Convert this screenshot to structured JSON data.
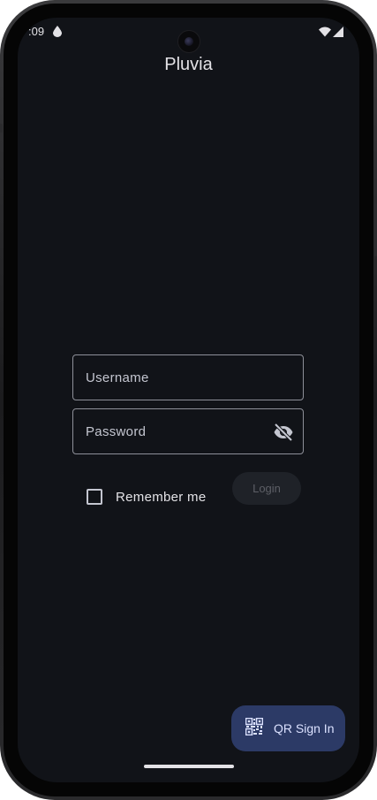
{
  "status_bar": {
    "time": ":09",
    "icons": [
      "water-drop-icon",
      "wifi-icon",
      "signal-icon"
    ]
  },
  "app": {
    "title": "Pluvia"
  },
  "login_form": {
    "username": {
      "label": "Username",
      "value": ""
    },
    "password": {
      "label": "Password",
      "value": "",
      "visibility_icon": "visibility-off-icon"
    },
    "remember_me": {
      "label": "Remember me",
      "checked": false
    },
    "login_button": {
      "label": "Login",
      "enabled": false
    }
  },
  "qr_sign_in": {
    "label": "QR Sign In",
    "icon": "qr-code-icon"
  },
  "colors": {
    "background": "#111318",
    "text": "#e3e2e6",
    "outline": "#8e9099",
    "fab_background": "#2c3a66",
    "fab_text": "#dbe1ff",
    "disabled_button": "#1f2228",
    "disabled_text": "#5d5f66"
  }
}
